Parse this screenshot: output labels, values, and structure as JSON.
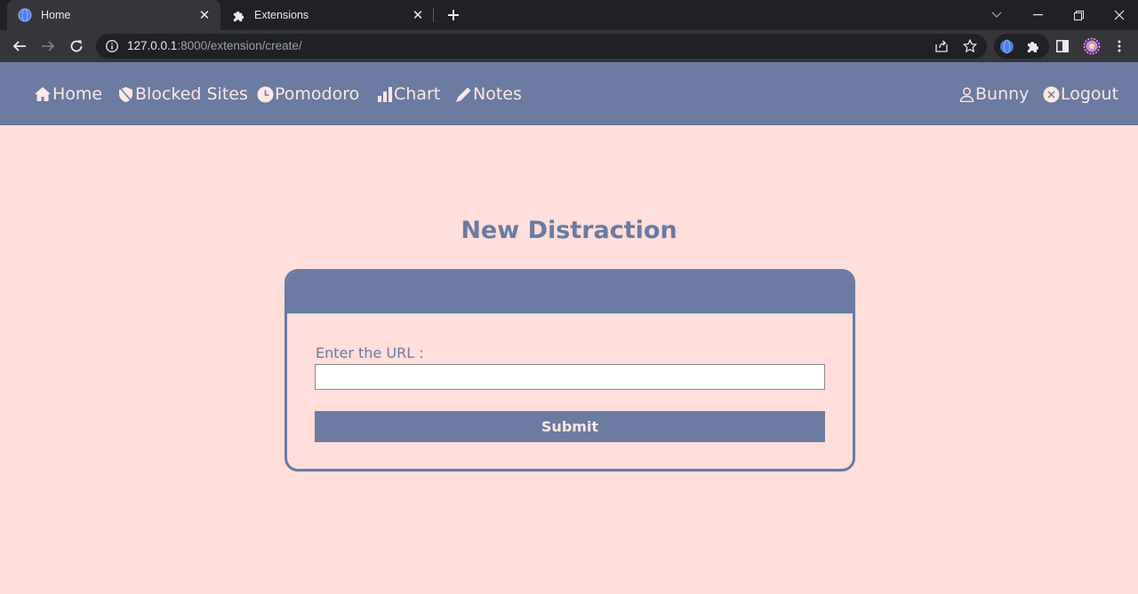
{
  "browser": {
    "tabs": [
      {
        "title": "Home",
        "icon": "globe-icon",
        "active": true
      },
      {
        "title": "Extensions",
        "icon": "puzzle-icon",
        "active": false
      }
    ],
    "address": {
      "host": "127.0.0.1",
      "path": ":8000/extension/create/"
    }
  },
  "site": {
    "nav": [
      {
        "label": "Home",
        "icon": "house-icon"
      },
      {
        "label": "Blocked Sites",
        "icon": "shield-slash-icon"
      },
      {
        "label": "Pomodoro",
        "icon": "clock-icon"
      },
      {
        "label": "Chart",
        "icon": "bar-chart-icon"
      },
      {
        "label": "Notes",
        "icon": "pencil-icon"
      }
    ],
    "user": {
      "label": "Bunny",
      "icon": "user-icon"
    },
    "logout": {
      "label": "Logout",
      "icon": "x-circle-icon"
    }
  },
  "page": {
    "heading": "New Distraction",
    "form": {
      "url_label": "Enter the URL :",
      "url_value": "",
      "submit_label": "Submit"
    }
  },
  "colors": {
    "background": "#ffdedc",
    "accent": "#6b7ba1",
    "nav_text": "#ffe7e5"
  }
}
